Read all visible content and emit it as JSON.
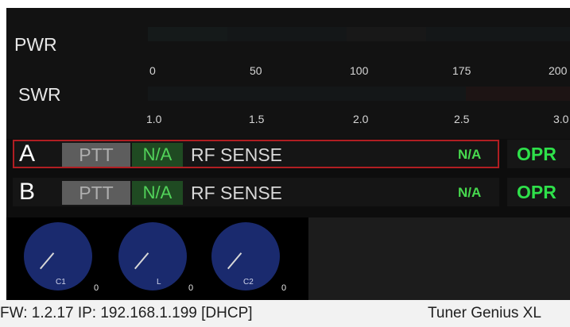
{
  "meters": {
    "pwr_label": "PWR",
    "swr_label": "SWR",
    "pwr_ticks": [
      "0",
      "50",
      "100",
      "175",
      "200"
    ],
    "swr_ticks": [
      "1.0",
      "1.5",
      "2.0",
      "2.5",
      "3.0"
    ],
    "pwr_level": 0,
    "swr_level": 0
  },
  "radios": [
    {
      "letter": "A",
      "ptt": "PTT",
      "status": "N/A",
      "mode": "RF SENSE",
      "value": "N/A",
      "opr": "OPR",
      "selected": true
    },
    {
      "letter": "B",
      "ptt": "PTT",
      "status": "N/A",
      "mode": "RF SENSE",
      "value": "N/A",
      "opr": "OPR",
      "selected": false
    }
  ],
  "knobs": [
    {
      "label": "C1",
      "value": "0"
    },
    {
      "label": "L",
      "value": "0"
    },
    {
      "label": "C2",
      "value": "0"
    }
  ],
  "status": {
    "info": "FW: 1.2.17 IP: 192.168.1.199 [DHCP]",
    "device": "Tuner Genius XL"
  },
  "colors": {
    "selected_border": "#b01e22",
    "ok_green": "#2ee04a",
    "knob_blue": "#1a2a6e"
  }
}
